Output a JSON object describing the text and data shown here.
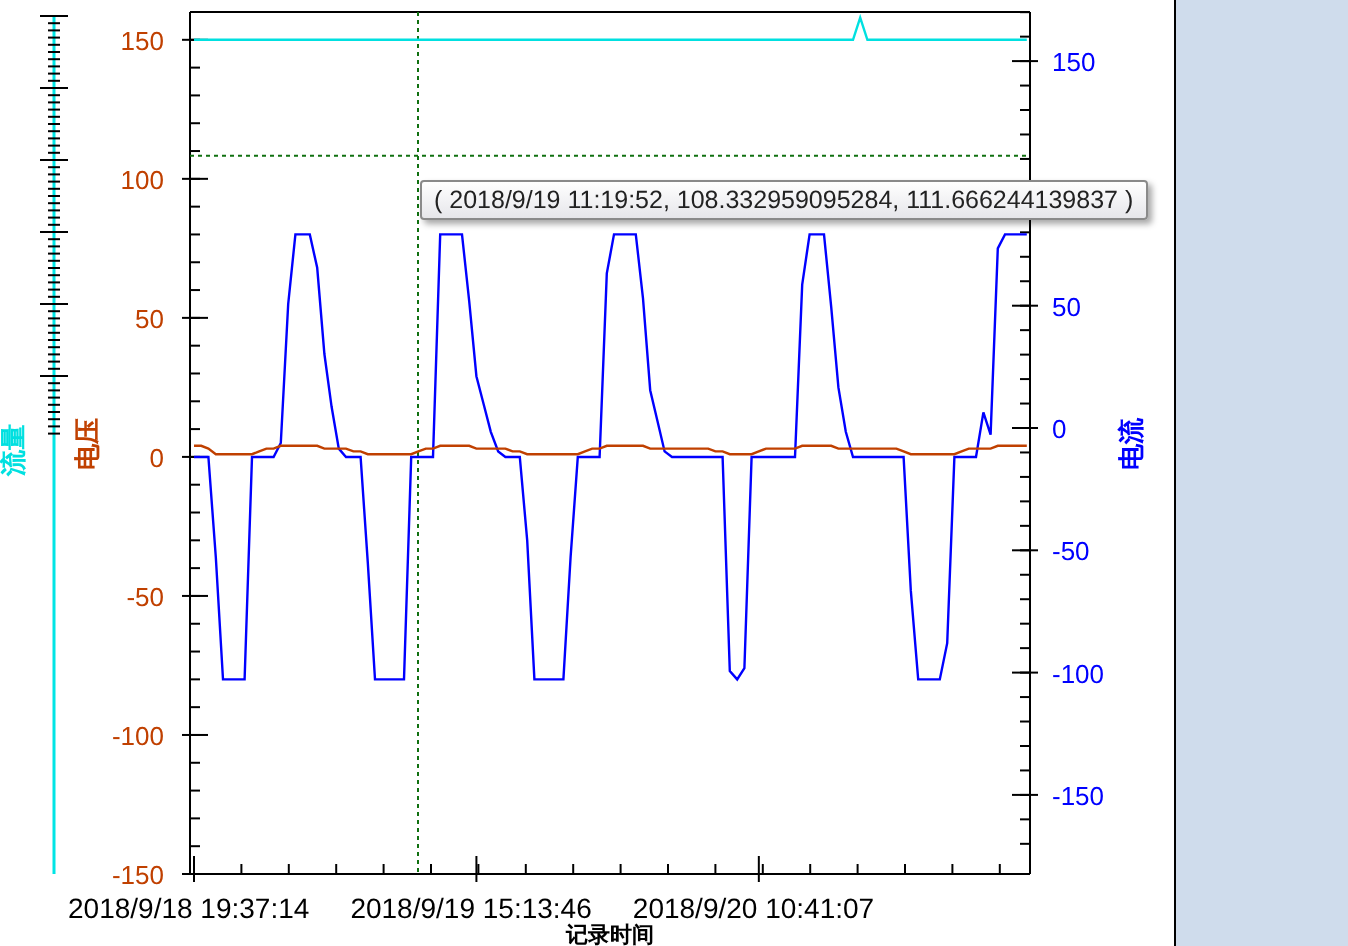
{
  "chart": {
    "chart_data": {
      "type": "line",
      "xlabel": "记录时间",
      "categories": [
        "2018/9/18 19:37:14",
        null,
        null,
        null,
        null,
        null,
        null,
        null,
        null,
        null,
        null,
        null,
        null,
        null,
        null,
        null,
        null,
        null,
        null,
        null,
        null,
        null,
        null,
        null,
        null,
        null,
        null,
        null,
        null,
        null,
        null,
        null,
        null,
        null,
        null,
        null,
        null,
        null,
        null,
        "2018/9/19 15:13:46",
        null,
        null,
        null,
        null,
        null,
        null,
        null,
        null,
        null,
        null,
        null,
        null,
        null,
        null,
        null,
        null,
        null,
        null,
        null,
        null,
        null,
        null,
        null,
        null,
        null,
        null,
        null,
        null,
        null,
        null,
        null,
        null,
        null,
        null,
        null,
        null,
        null,
        null,
        "2018/9/20 10:41:07",
        null,
        null,
        null,
        null,
        null,
        null,
        null,
        null,
        null,
        null,
        null,
        null,
        null,
        null,
        null,
        null,
        null,
        null,
        null,
        null,
        null,
        null,
        null,
        null,
        null,
        null,
        null,
        null,
        null,
        null,
        null,
        null,
        null,
        null,
        null,
        null,
        null
      ],
      "series": [
        {
          "name": "电流",
          "color": "#0000ff",
          "values": [
            0,
            0,
            0,
            -36,
            -80,
            -80,
            -80,
            -80,
            0,
            0,
            0,
            0,
            5,
            55,
            80,
            80,
            80,
            68,
            37,
            18,
            3,
            0,
            0,
            0,
            -38,
            -80,
            -80,
            -80,
            -80,
            -80,
            0,
            0,
            0,
            0,
            80,
            80,
            80,
            80,
            56,
            29,
            19,
            9,
            2,
            0,
            0,
            0,
            -30,
            -80,
            -80,
            -80,
            -80,
            -80,
            -36,
            0,
            0,
            0,
            0,
            66,
            80,
            80,
            80,
            80,
            57,
            24,
            13,
            2,
            0,
            0,
            0,
            0,
            0,
            0,
            0,
            0,
            -77,
            -80,
            -76,
            0,
            0,
            0,
            0,
            0,
            0,
            0,
            62,
            80,
            80,
            80,
            54,
            25,
            9,
            0,
            0,
            0,
            0,
            0,
            0,
            0,
            0,
            -48,
            -80,
            -80,
            -80,
            -80,
            -67,
            0,
            0,
            0,
            0,
            16,
            8,
            75,
            80,
            80,
            80,
            80
          ]
        },
        {
          "name": "电压",
          "color": "#c04000",
          "values": [
            4,
            4,
            3,
            1,
            1,
            1,
            1,
            1,
            1,
            2,
            3,
            3,
            4,
            4,
            4,
            4,
            4,
            4,
            3,
            3,
            3,
            3,
            2,
            2,
            1,
            1,
            1,
            1,
            1,
            1,
            1,
            2,
            3,
            3,
            4,
            4,
            4,
            4,
            4,
            3,
            3,
            3,
            3,
            3,
            2,
            2,
            1,
            1,
            1,
            1,
            1,
            1,
            1,
            1,
            2,
            3,
            3,
            4,
            4,
            4,
            4,
            4,
            4,
            3,
            3,
            3,
            3,
            3,
            3,
            3,
            3,
            3,
            2,
            2,
            1,
            1,
            1,
            1,
            2,
            3,
            3,
            3,
            3,
            3,
            4,
            4,
            4,
            4,
            4,
            3,
            3,
            3,
            3,
            3,
            3,
            3,
            3,
            3,
            2,
            1,
            1,
            1,
            1,
            1,
            1,
            1,
            2,
            3,
            3,
            3,
            3,
            4,
            4,
            4,
            4,
            4
          ]
        },
        {
          "name": "流量",
          "color": "#00e0e0",
          "values": [
            150,
            150,
            150,
            150,
            150,
            150,
            150,
            150,
            150,
            150,
            150,
            150,
            150,
            150,
            150,
            150,
            150,
            150,
            150,
            150,
            150,
            150,
            150,
            150,
            150,
            150,
            150,
            150,
            150,
            150,
            150,
            150,
            150,
            150,
            150,
            150,
            150,
            150,
            150,
            150,
            150,
            150,
            150,
            150,
            150,
            150,
            150,
            150,
            150,
            150,
            150,
            150,
            150,
            150,
            150,
            150,
            150,
            150,
            150,
            150,
            150,
            150,
            150,
            150,
            150,
            150,
            150,
            150,
            150,
            150,
            150,
            150,
            150,
            150,
            150,
            150,
            150,
            150,
            150,
            150,
            150,
            150,
            150,
            150,
            150,
            150,
            150,
            150,
            150,
            150,
            150,
            150,
            158,
            150,
            150,
            150,
            150,
            150,
            150,
            150,
            150,
            150,
            150,
            150,
            150,
            150,
            150,
            150,
            150,
            150,
            150,
            150,
            150,
            150,
            150,
            150
          ]
        }
      ],
      "ylim": [
        -150,
        160
      ],
      "ref_lines": [
        {
          "axis": "y",
          "value": 108.33
        }
      ],
      "yticks": [
        {
          "value": 150,
          "label": "150"
        },
        {
          "value": 100,
          "label": "100"
        },
        {
          "value": 50,
          "label": "50"
        },
        {
          "value": 0,
          "label": "0"
        },
        {
          "value": -50,
          "label": "-50"
        },
        {
          "value": -100,
          "label": "-100"
        },
        {
          "value": -150,
          "label": "-150"
        }
      ]
    },
    "tooltip": "( 2018/9/19 11:19:52, 108.332959095284, 111.666244139837 )",
    "right_axis": {
      "ticks": [
        "150",
        "50",
        "0",
        "-50",
        "-100",
        "-150"
      ]
    }
  }
}
